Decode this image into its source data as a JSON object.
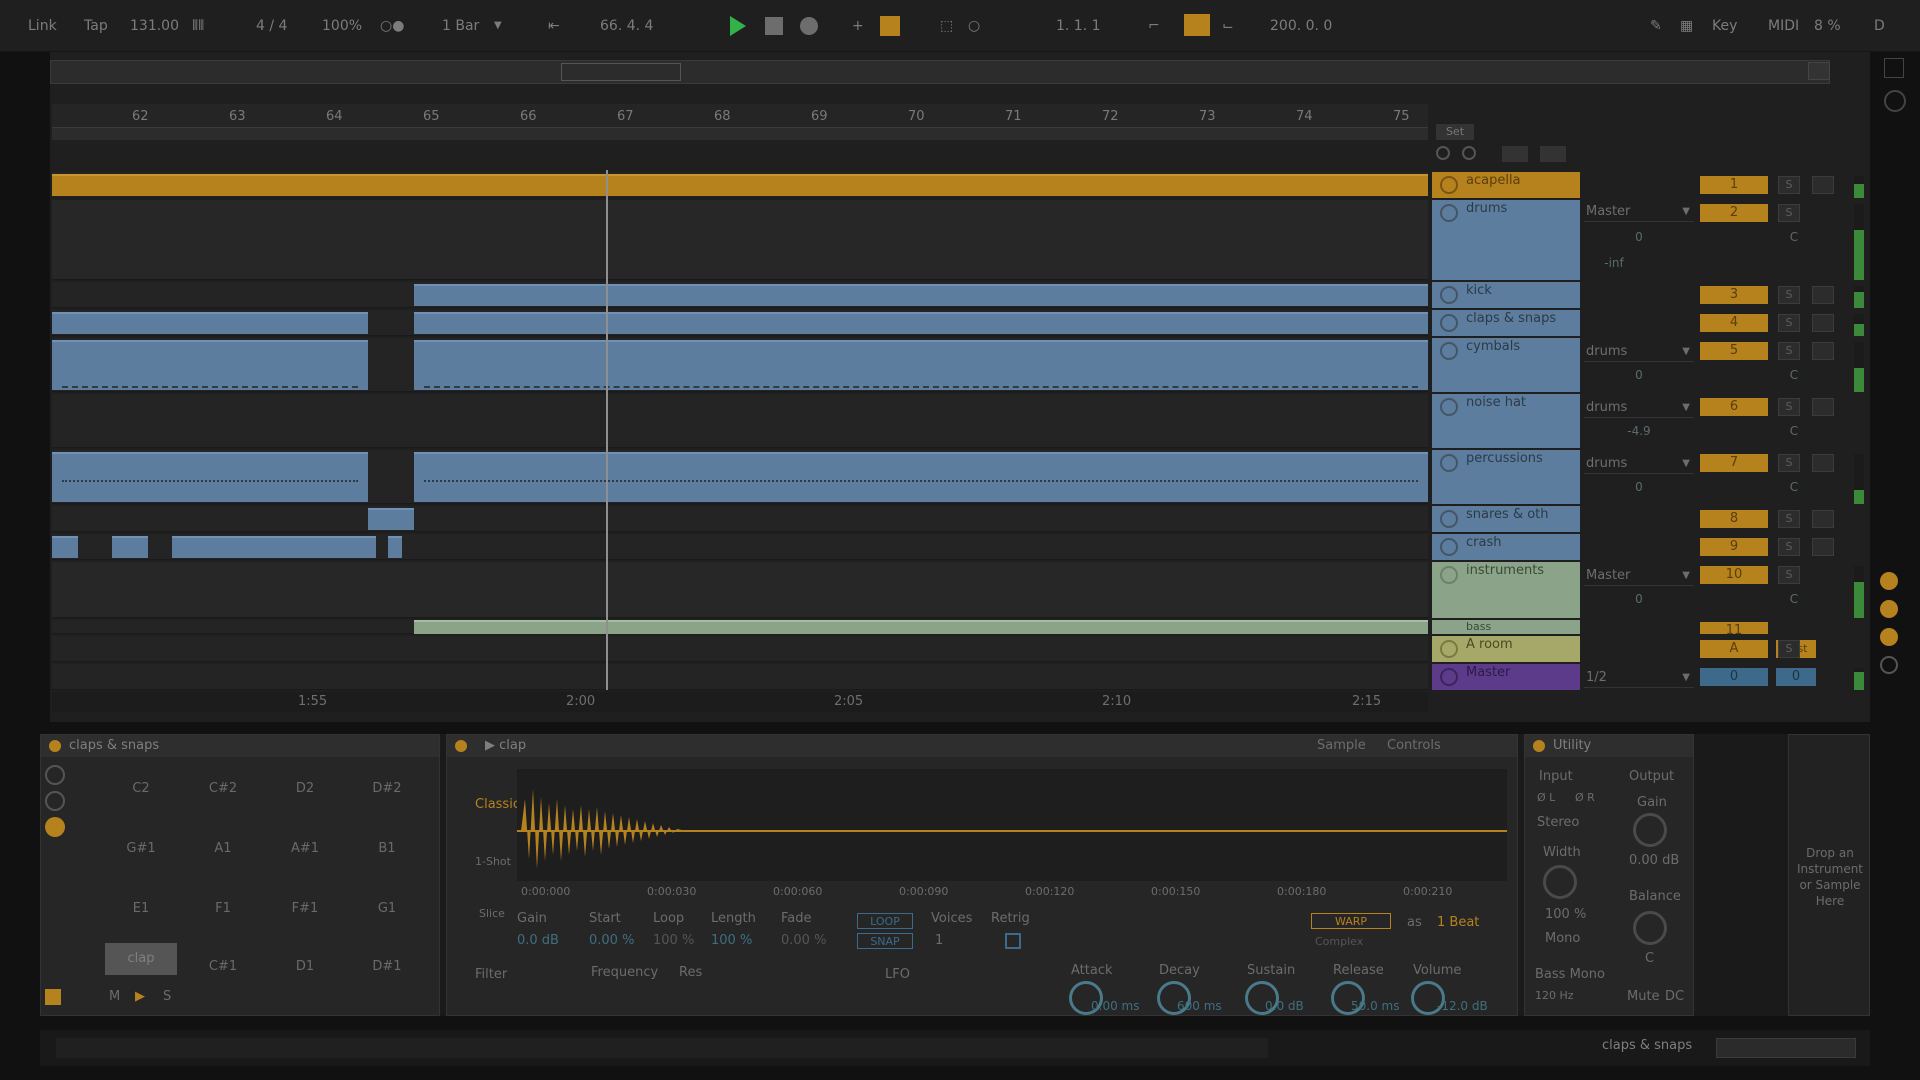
{
  "transport": {
    "link": "Link",
    "tap": "Tap",
    "tempo": "131.00",
    "time_sig": "4 / 4",
    "zoom": "100%",
    "quantize": "1 Bar",
    "position": "66.  4.  4",
    "loop_start": "1.  1.  1",
    "loop_length": "200.  0.  0",
    "key": "Key",
    "midi": "MIDI",
    "cpu": "8 %",
    "disk": "D"
  },
  "arrangement": {
    "bar_numbers": [
      "62",
      "63",
      "64",
      "65",
      "66",
      "67",
      "68",
      "69",
      "70",
      "71",
      "72",
      "73",
      "74",
      "75"
    ],
    "times": [
      "1:55",
      "2:00",
      "2:05",
      "2:10",
      "2:15"
    ],
    "set_label": "Set"
  },
  "tracks": [
    {
      "name": "acapella",
      "num": "1"
    },
    {
      "name": "drums",
      "num": "2",
      "output": "Master",
      "vol": "0",
      "pan": "C",
      "gain": "-inf"
    },
    {
      "name": "kick",
      "num": "3"
    },
    {
      "name": "claps & snaps",
      "num": "4"
    },
    {
      "name": "cymbals",
      "num": "5",
      "output": "drums",
      "vol": "0",
      "pan": "C"
    },
    {
      "name": "noise hat",
      "num": "6",
      "output": "drums",
      "vol": "-4.9",
      "pan": "C"
    },
    {
      "name": "percussions",
      "num": "7",
      "output": "drums",
      "vol": "0",
      "pan": "C"
    },
    {
      "name": "snares & oth",
      "num": "8"
    },
    {
      "name": "crash",
      "num": "9"
    },
    {
      "name": "instruments",
      "num": "10",
      "output": "Master",
      "vol": "0",
      "pan": "C"
    },
    {
      "name": "bass",
      "num": "11"
    },
    {
      "name": "A room",
      "num": "A",
      "extra": "Post"
    },
    {
      "name": "Master",
      "output": "1/2",
      "vol": "0",
      "pan": "0"
    }
  ],
  "drum_rack": {
    "title": "claps & snaps",
    "pads": [
      "C2",
      "C#2",
      "D2",
      "D#2",
      "G#1",
      "A1",
      "A#1",
      "B1",
      "E1",
      "F1",
      "F#1",
      "G1",
      "clap",
      "C#1",
      "D1",
      "D#1"
    ],
    "pad_controls": [
      "M",
      "▶",
      "S"
    ]
  },
  "simpler": {
    "title": "clap",
    "tabs": [
      "Sample",
      "Controls"
    ],
    "mode": "Classic",
    "one_shot": "1-Shot",
    "slice": "Slice",
    "times": [
      "0:00:000",
      "0:00:030",
      "0:00:060",
      "0:00:090",
      "0:00:120",
      "0:00:150",
      "0:00:180",
      "0:00:210"
    ],
    "labels": {
      "gain": "Gain",
      "start": "Start",
      "loop": "Loop",
      "length": "Length",
      "fade": "Fade",
      "voices": "Voices",
      "retrig": "Retrig"
    },
    "values": {
      "gain": "0.0 dB",
      "start": "0.00 %",
      "loop": "100 %",
      "length": "100 %",
      "fade": "0.00 %",
      "voices": "1"
    },
    "loop_btn": "LOOP",
    "snap_btn": "SNAP",
    "warp_btn": "WARP",
    "as": "as",
    "beat": "1 Beat",
    "warp_mode": "Complex",
    "filter": "Filter",
    "frequency": "Frequency",
    "res": "Res",
    "lfo": "LFO",
    "envelope": [
      {
        "label": "Attack",
        "value": "0.00 ms"
      },
      {
        "label": "Decay",
        "value": "600 ms"
      },
      {
        "label": "Sustain",
        "value": "0.0 dB"
      },
      {
        "label": "Release",
        "value": "50.0 ms"
      },
      {
        "label": "Volume",
        "value": "-12.0 dB"
      }
    ]
  },
  "utility": {
    "title": "Utility",
    "input": "Input",
    "output": "Output",
    "gain": "Gain",
    "gain_val": "0.00 dB",
    "stereo": "Stereo",
    "width": "Width",
    "width_val": "100 %",
    "balance": "Balance",
    "balance_val": "C",
    "mono": "Mono",
    "bass_mono": "Bass Mono",
    "hz": "120 Hz",
    "mute": "Mute",
    "dc": "DC",
    "left": "Ø L",
    "right": "Ø R"
  },
  "drop_zone": "Drop an Instrument or Sample Here",
  "status": {
    "track": "claps & snaps"
  },
  "colors": {
    "accent": "#b5821e",
    "clip_blue": "#5c7d9e",
    "clip_green": "#8aa389",
    "play_green": "#33b24a",
    "master_purple": "#5c3b8a"
  }
}
